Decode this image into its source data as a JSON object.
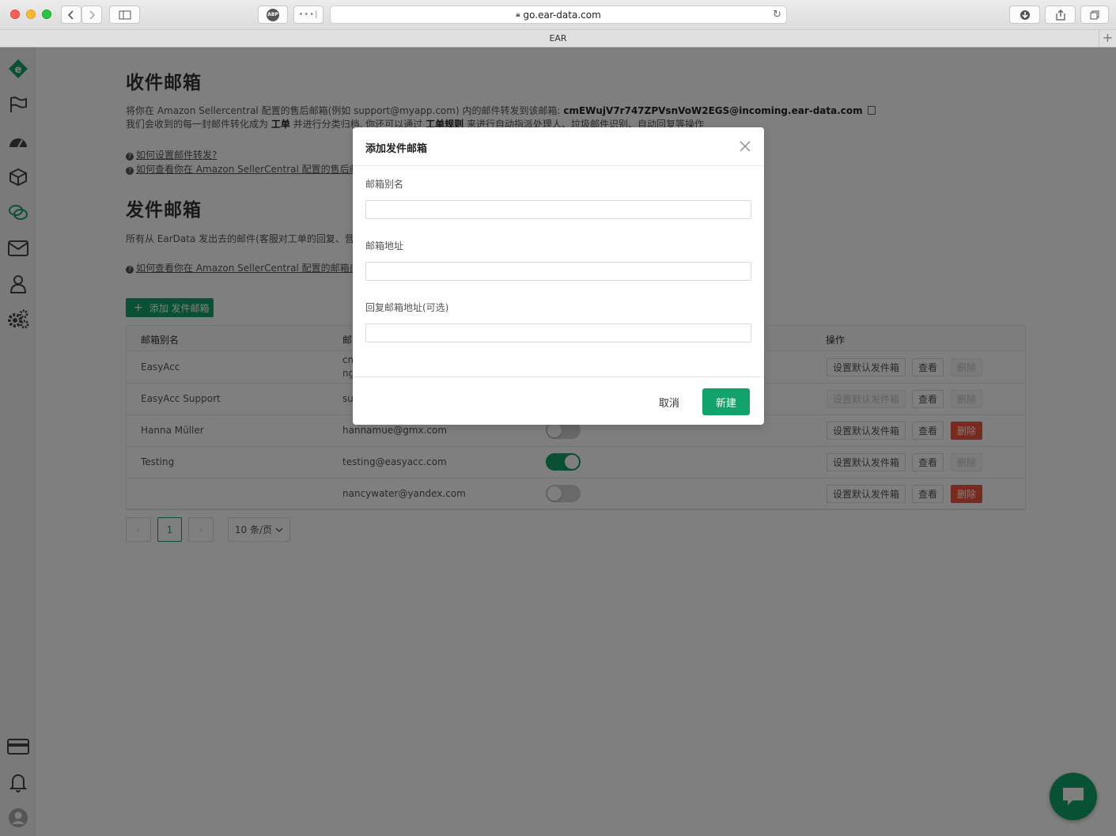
{
  "browser": {
    "url": "go.ear-data.com",
    "tab_title": "EAR",
    "abp_label": "ABP"
  },
  "sidebar": {
    "items": [
      {
        "icon": "logo-icon"
      },
      {
        "icon": "flag-icon"
      },
      {
        "icon": "dashboard-icon"
      },
      {
        "icon": "box-icon"
      },
      {
        "icon": "chat-icon"
      },
      {
        "icon": "mail-icon"
      },
      {
        "icon": "user-icon"
      },
      {
        "icon": "settings-icon"
      }
    ],
    "bottom": [
      {
        "icon": "card-icon"
      },
      {
        "icon": "bell-icon"
      },
      {
        "icon": "avatar-icon"
      }
    ]
  },
  "inbox": {
    "title": "收件邮箱",
    "desc1_prefix": "将你在 Amazon Sellercentral 配置的售后邮箱(例如 support@myapp.com) 内的邮件转发到该邮箱: ",
    "desc1_email": "cmEWujV7r747ZPVsnVoW2EGS@incoming.ear-data.com",
    "desc2_a": "我们会收到的每一封邮件转化成为 ",
    "desc2_b": "工单",
    "desc2_c": " 并进行分类归档, 你还可以通过 ",
    "desc2_d": "工单规则",
    "desc2_e": " 来进行自动指派处理人、垃圾邮件识别、自动回复等操作",
    "link1": "如何设置邮件转发?",
    "link2": "如何查看你在 Amazon SellerCentral 配置的售后邮箱"
  },
  "outbox": {
    "title": "发件邮箱",
    "desc": "所有从 EarData 发出去的邮件(客服对工单的回复、营销",
    "link": "如何查看你在 Amazon SellerCentral 配置的邮箱白名",
    "add_button": "添加 发件邮箱"
  },
  "table": {
    "headers": {
      "alias": "邮箱别名",
      "address": "邮",
      "action": "操作"
    },
    "set_default_label": "设置默认发件箱",
    "view_label": "查看",
    "delete_label": "删除",
    "rows": [
      {
        "alias": "EasyAcc",
        "address": "cm",
        "address2": "ng",
        "enabled": null,
        "can_delete": false,
        "can_set_default": true
      },
      {
        "alias": "EasyAcc Support",
        "address": "su",
        "address2": "",
        "enabled": null,
        "can_delete": false,
        "can_set_default": false
      },
      {
        "alias": "Hanna Müller",
        "address": "hannamue@gmx.com",
        "address2": "",
        "enabled": false,
        "can_delete": true,
        "can_set_default": true
      },
      {
        "alias": "Testing",
        "address": "testing@easyacc.com",
        "address2": "",
        "enabled": true,
        "can_delete": false,
        "can_set_default": true
      },
      {
        "alias": "",
        "address": "nancywater@yandex.com",
        "address2": "",
        "enabled": false,
        "can_delete": true,
        "can_set_default": true
      }
    ]
  },
  "pagination": {
    "prev": "‹",
    "current": "1",
    "next": "›",
    "page_size": "10 条/页"
  },
  "modal": {
    "title": "添加发件邮箱",
    "fields": [
      {
        "label": "邮箱别名",
        "value": "",
        "placeholder": ""
      },
      {
        "label": "邮箱地址",
        "value": "",
        "placeholder": ""
      },
      {
        "label": "回复邮箱地址(可选)",
        "value": "",
        "placeholder": ""
      }
    ],
    "cancel": "取消",
    "ok": "新建"
  },
  "colors": {
    "accent": "#12a36b",
    "danger": "#f0543e"
  }
}
